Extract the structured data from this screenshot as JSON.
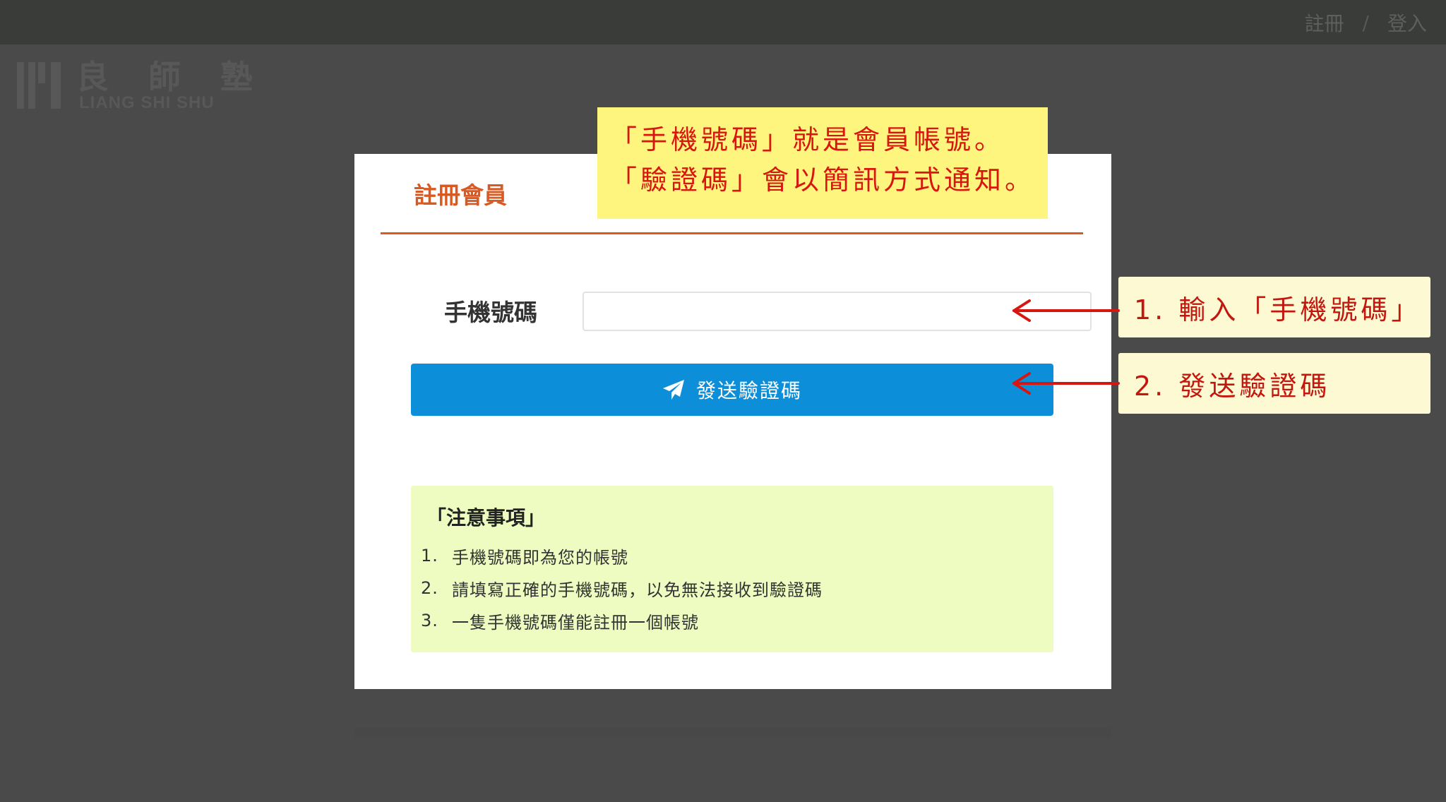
{
  "topnav": {
    "register": "註冊",
    "separator": "/",
    "login": "登入"
  },
  "logo": {
    "chars": [
      "良",
      "師",
      "塾"
    ],
    "subtitle": "LIANG SHI SHU"
  },
  "modal": {
    "title": "註冊會員",
    "phone_label": "手機號碼",
    "phone_value": "",
    "send_button": "發送驗證碼",
    "send_icon": "paper-plane-icon"
  },
  "notice": {
    "title": "「注意事項」",
    "items": [
      {
        "num": "1.",
        "text": "手機號碼即為您的帳號"
      },
      {
        "num": "2.",
        "text": "請填寫正確的手機號碼，以免無法接收到驗證碼"
      },
      {
        "num": "3.",
        "text": "一隻手機號碼僅能註冊一個帳號"
      }
    ]
  },
  "annotations": {
    "top_note": [
      "「手機號碼」就是會員帳號。",
      "「驗證碼」會以簡訊方式通知。"
    ],
    "step1": "1. 輸入「手機號碼」",
    "step2": "2. 發送驗證碼"
  },
  "colors": {
    "accent": "#dd5a1a",
    "button": "#0c8fd8",
    "annotation_text": "#d8150f",
    "notice_bg": "#eefcc2",
    "note_bg": "#fef57e"
  }
}
